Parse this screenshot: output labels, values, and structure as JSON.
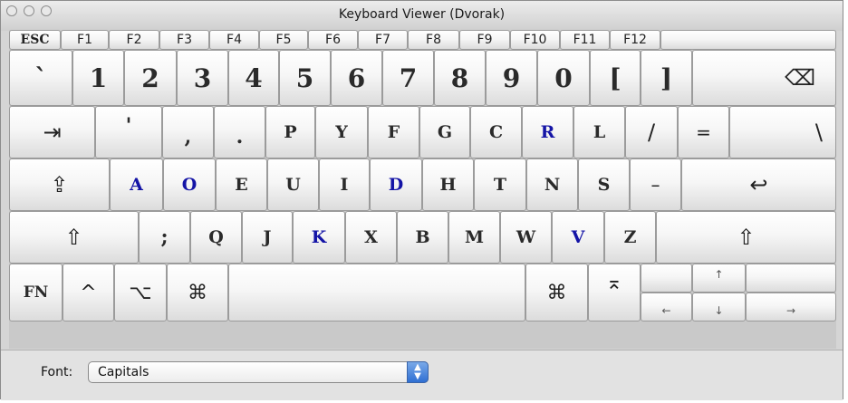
{
  "window": {
    "title": "Keyboard Viewer (Dvorak)"
  },
  "function_row": [
    "ESC",
    "F1",
    "F2",
    "F3",
    "F4",
    "F5",
    "F6",
    "F7",
    "F8",
    "F9",
    "F10",
    "F11",
    "F12"
  ],
  "number_row": [
    "`",
    "1",
    "2",
    "3",
    "4",
    "5",
    "6",
    "7",
    "8",
    "9",
    "0",
    "[",
    "]",
    "⌫"
  ],
  "top_row": [
    "⇥",
    "'",
    ",",
    ".",
    "P",
    "Y",
    "F",
    "G",
    "C",
    "R",
    "L",
    "/",
    "=",
    "\\"
  ],
  "home_row": [
    "⇪",
    "A",
    "O",
    "E",
    "U",
    "I",
    "D",
    "H",
    "T",
    "N",
    "S",
    "–",
    "↩"
  ],
  "bottom_row": [
    "⇧",
    ";",
    "Q",
    "J",
    "K",
    "X",
    "B",
    "M",
    "W",
    "V",
    "Z",
    "⇧"
  ],
  "modifier_row": [
    "FN",
    "^",
    "⌥",
    "⌘",
    "⌘",
    "⌅"
  ],
  "arrows": {
    "up": "↑",
    "left": "←",
    "down": "↓",
    "right": "→"
  },
  "font_selector": {
    "label": "Font:",
    "value": "Capitals"
  },
  "colors": {
    "highlight_key_text": "#1414a6",
    "select_button": "#2f6fd3"
  }
}
